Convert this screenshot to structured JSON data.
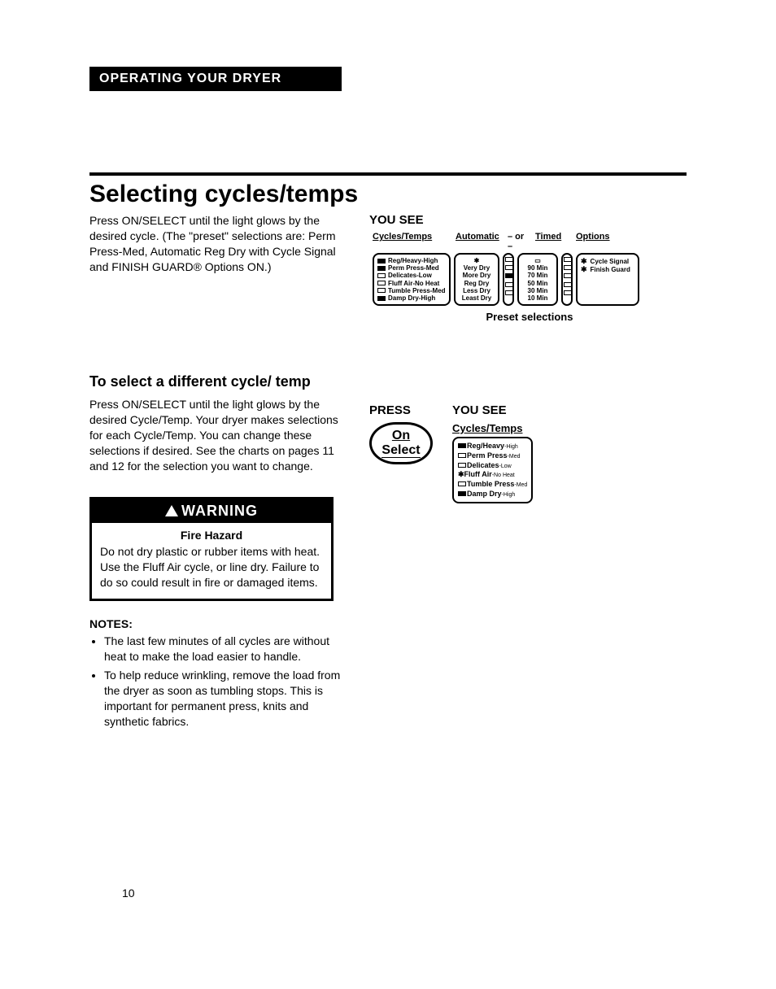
{
  "section_header": "OPERATING YOUR DRYER",
  "main_title": "Selecting cycles/temps",
  "intro_text": "Press ON/SELECT until the light glows by the desired cycle. (The \"preset\" selections are: Perm Press-Med, Automatic Reg Dry with Cycle Signal and FINISH GUARD® Options ON.)",
  "you_see": "YOU SEE",
  "panel_headers": {
    "cycles": "Cycles/Temps",
    "auto": "Automatic",
    "or": "– or –",
    "timed": "Timed",
    "options": "Options"
  },
  "cycles_list": [
    "Reg/Heavy-High",
    "Perm Press-Med",
    "Delicates-Low",
    "Fluff Air-No Heat",
    "Tumble Press-Med",
    "Damp Dry-High"
  ],
  "auto_list": [
    "Very Dry",
    "More Dry",
    "Reg Dry",
    "Less Dry",
    "Least Dry"
  ],
  "timed_list": [
    "90 Min",
    "70 Min",
    "50 Min",
    "30 Min",
    "10 Min"
  ],
  "options_list": [
    "Cycle Signal",
    "Finish Guard"
  ],
  "preset_caption": "Preset selections",
  "sub_title": "To select a different cycle/ temp",
  "sub_text": "Press ON/SELECT until the light glows by the desired Cycle/Temp. Your dryer makes selections for each Cycle/Temp. You can change these selections if desired. See the charts on pages 11 and 12 for the selection you want to change.",
  "warning": {
    "header": "WARNING",
    "hazard": "Fire Hazard",
    "body": "Do not dry plastic or rubber items with heat. Use the Fluff Air cycle, or line dry. Failure to do so could result in fire or damaged items."
  },
  "notes_label": "NOTES:",
  "notes": [
    "The last few minutes of all cycles are without heat to make the load easier to handle.",
    "To help reduce wrinkling, remove the load from the dryer as soon as tumbling stops. This is important for permanent press, knits and synthetic fabrics."
  ],
  "press_label": "PRESS",
  "you_see2": "YOU SEE",
  "press_button": {
    "on": "On",
    "select": "Select"
  },
  "ct_title": "Cycles/Temps",
  "ct_list": [
    {
      "main": "Reg/Heavy",
      "sub": "-High"
    },
    {
      "main": "Perm Press",
      "sub": "-Med"
    },
    {
      "main": "Delicates",
      "sub": "-Low"
    },
    {
      "main": "Fluff Air",
      "sub": "-No Heat"
    },
    {
      "main": "Tumble Press",
      "sub": "-Med"
    },
    {
      "main": "Damp Dry",
      "sub": "-High"
    }
  ],
  "page_number": "10"
}
